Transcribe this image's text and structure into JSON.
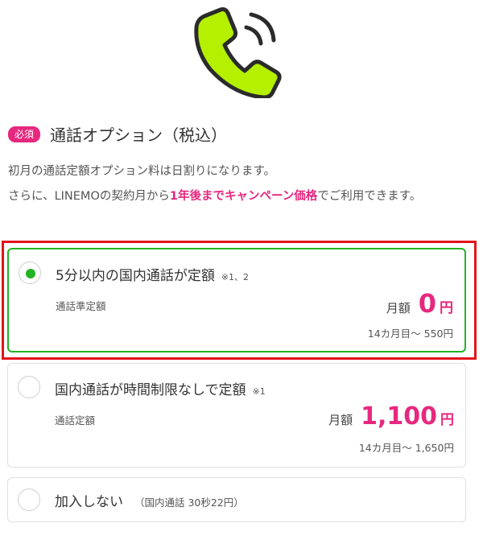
{
  "header": {
    "icon": "phone-call-icon",
    "badge": "必須",
    "title": "通話オプション（税込）"
  },
  "note": {
    "line1": "初月の通話定額オプション料は日割りになります。",
    "line2_prefix": "さらに、LINEMOの契約月から",
    "line2_highlight": "1年後までキャンペーン価格",
    "line2_suffix": "でご利用できます。"
  },
  "options": [
    {
      "title": "5分以内の国内通話が定額",
      "footnote": "※1、2",
      "subtitle": "通話準定額",
      "price_label": "月額",
      "price": "0",
      "unit": "円",
      "after": "14カ月目〜 550円",
      "selected": true
    },
    {
      "title": "国内通話が時間制限なしで定額",
      "footnote": "※1",
      "subtitle": "通話定額",
      "price_label": "月額",
      "price": "1,100",
      "unit": "円",
      "after": "14カ月目〜 1,650円",
      "selected": false
    },
    {
      "title": "加入しない",
      "footnote": "（国内通話 30秒22円）",
      "selected": false
    }
  ],
  "colors": {
    "accent_pink": "#e6287f",
    "selected_green": "#22b422",
    "outline_red": "#e2141b",
    "icon_lime": "#b4f000"
  }
}
